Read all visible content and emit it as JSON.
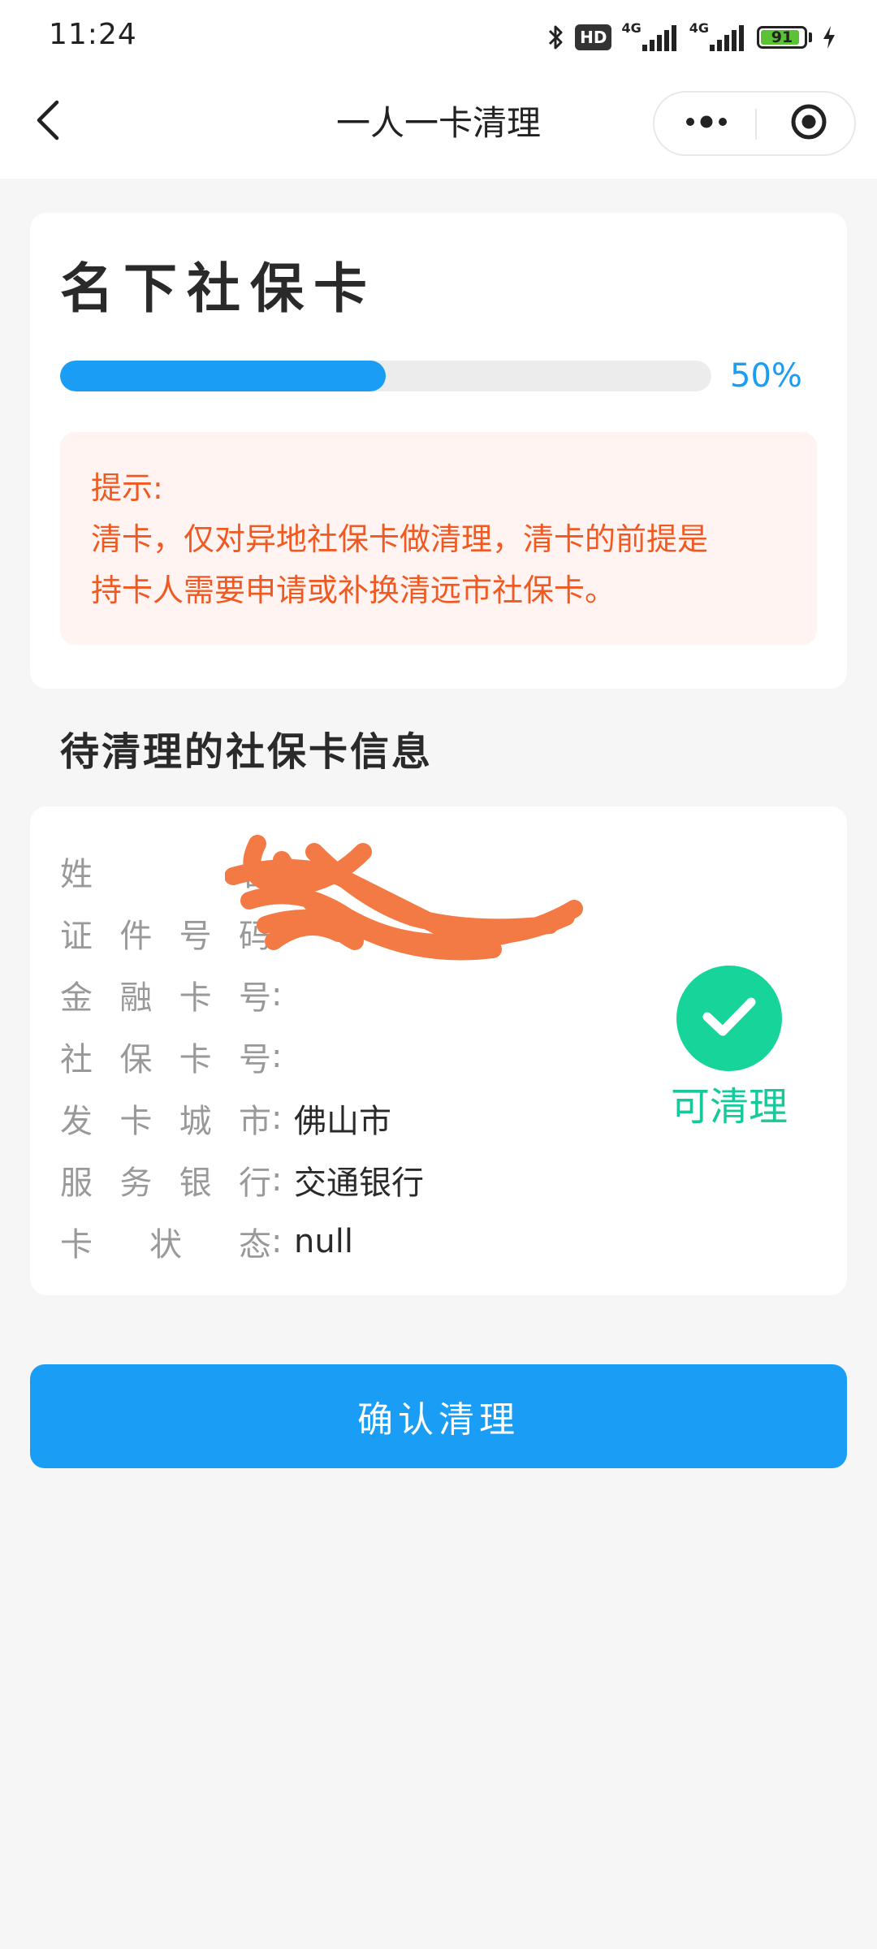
{
  "status_bar": {
    "time": "11:24",
    "hd_label": "HD",
    "network_1": "4G",
    "network_2": "4G",
    "battery": "91"
  },
  "nav": {
    "title": "一人一卡清理",
    "back_icon": "chevron-left-icon",
    "more_icon": "more-dots-icon",
    "close_icon": "target-circle-icon"
  },
  "summary": {
    "title": "名下社保卡",
    "progress_percent": "50%",
    "progress_value": 0.5,
    "notice_title": "提示:",
    "notice_lines": [
      "清卡，仅对异地社保卡做清理，清卡的前提是",
      "持卡人需要申请或补换清远市社保卡。"
    ]
  },
  "section_title": "待清理的社保卡信息",
  "info": {
    "colon": ":",
    "rows": [
      {
        "label": "姓名",
        "value": ""
      },
      {
        "label": "证件号码",
        "value": ""
      },
      {
        "label": "金融卡号",
        "value": ""
      },
      {
        "label": "社保卡号",
        "value": ""
      },
      {
        "label": "发卡城市",
        "value": "佛山市"
      },
      {
        "label": "服务银行",
        "value": "交通银行"
      },
      {
        "label": "卡状态",
        "value": "null"
      }
    ],
    "status_text": "可清理",
    "status_icon": "check-icon"
  },
  "confirm_button": "确认清理",
  "colors": {
    "primary": "#1a9df4",
    "success": "#17d59a",
    "warning_text": "#f05a22",
    "warning_bg": "#fff4f1",
    "redaction": "#f47a45"
  }
}
